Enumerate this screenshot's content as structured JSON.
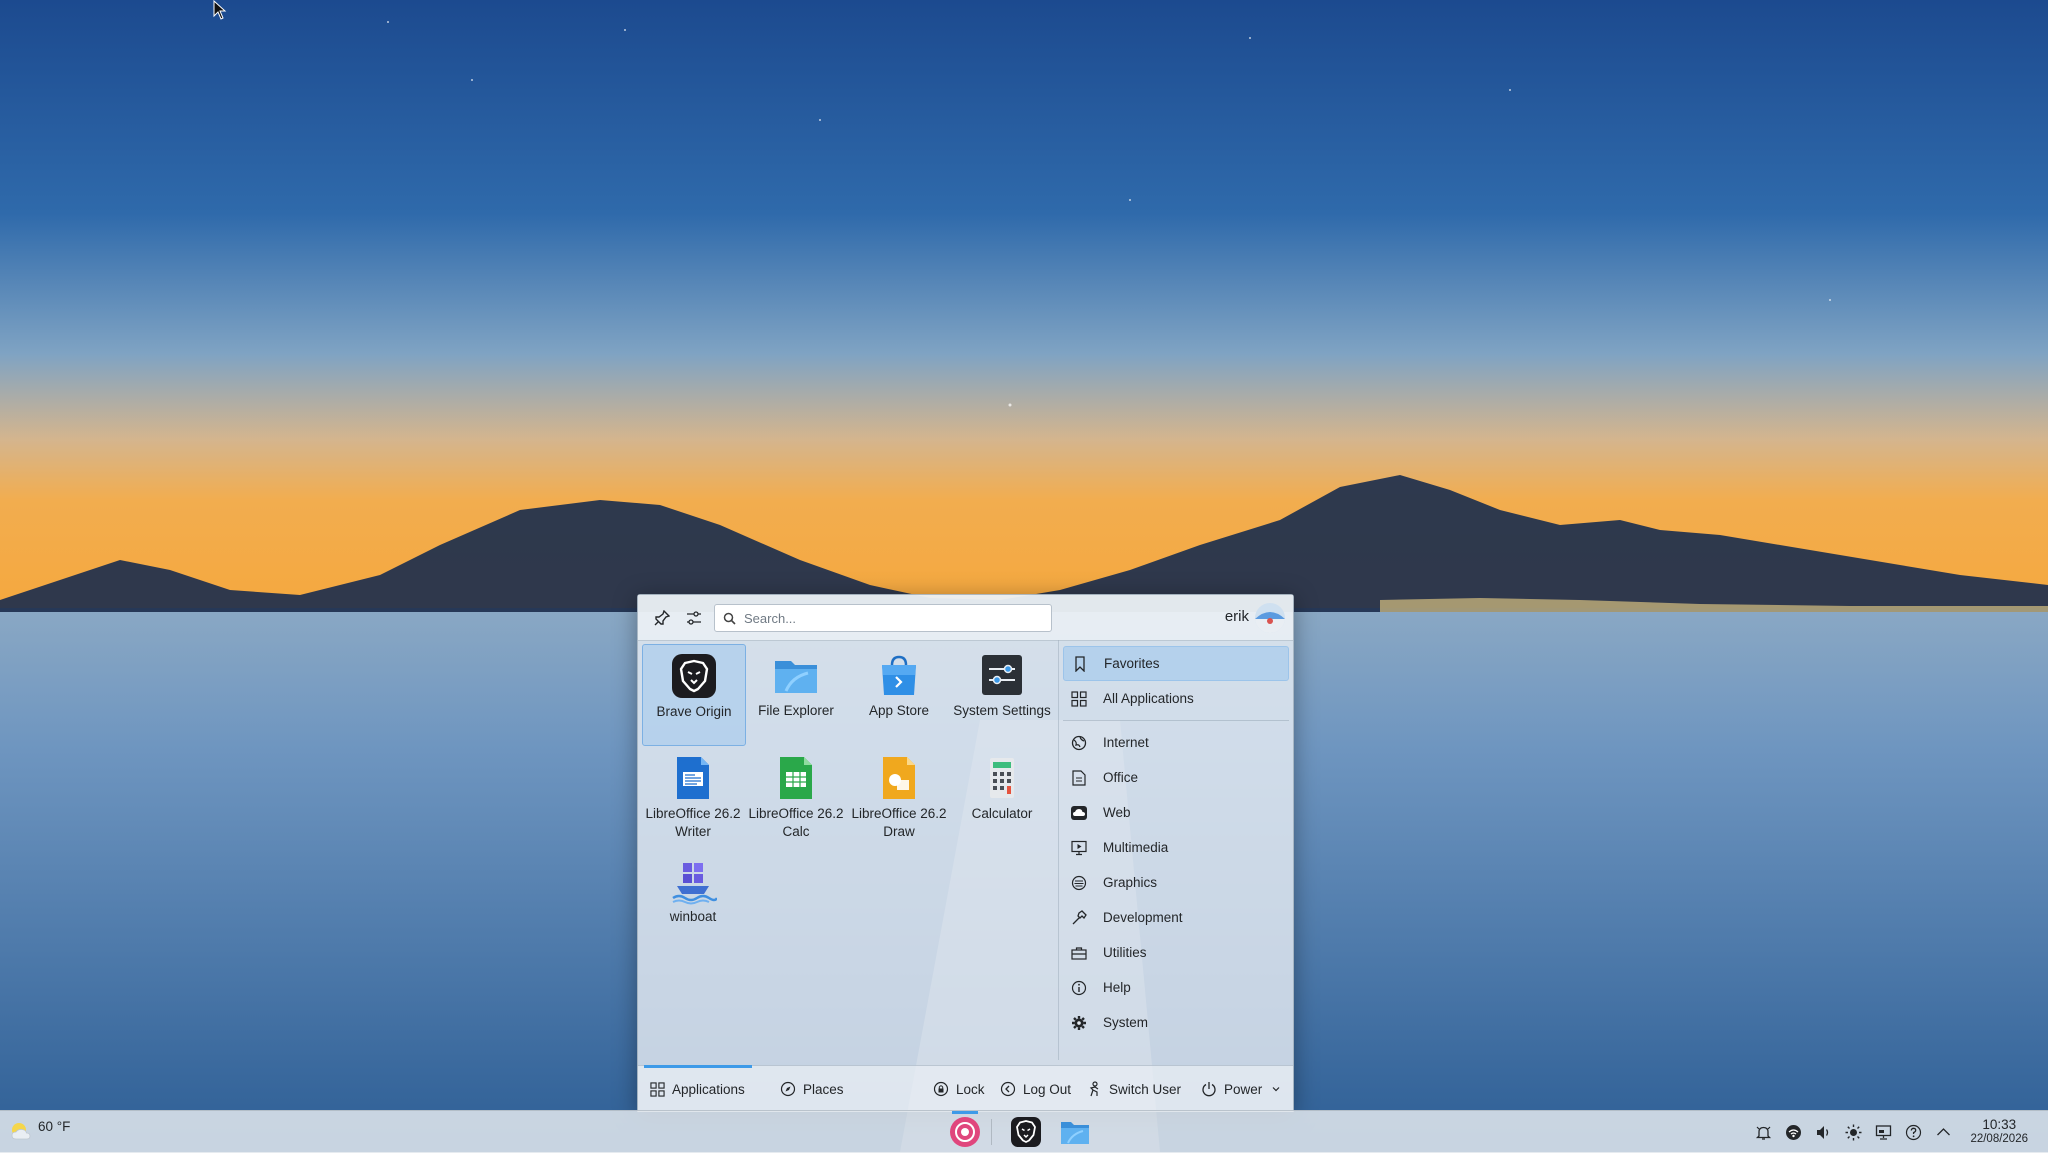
{
  "launcher": {
    "search_placeholder": "Search...",
    "user_name": "erik",
    "apps": [
      {
        "name": "Brave Origin",
        "icon": "brave-lion-icon",
        "selected": true
      },
      {
        "name": "File Explorer",
        "icon": "folder-icon"
      },
      {
        "name": "App Store",
        "icon": "app-store-bag-icon"
      },
      {
        "name": "System Settings",
        "icon": "settings-sliders-icon"
      },
      {
        "name": "LibreOffice 26.2 Writer",
        "icon": "writer-document-icon"
      },
      {
        "name": "LibreOffice 26.2 Calc",
        "icon": "calc-spreadsheet-icon"
      },
      {
        "name": "LibreOffice 26.2 Draw",
        "icon": "draw-shapes-icon"
      },
      {
        "name": "Calculator",
        "icon": "calculator-icon"
      },
      {
        "name": "winboat",
        "icon": "winboat-ship-icon"
      }
    ],
    "categories": [
      {
        "label": "Favorites",
        "icon": "bookmark-icon",
        "selected": true
      },
      {
        "label": "All Applications",
        "icon": "grid-icon"
      },
      {
        "label": "Internet",
        "icon": "globe-icon"
      },
      {
        "label": "Office",
        "icon": "document-icon"
      },
      {
        "label": "Web",
        "icon": "cloud-icon"
      },
      {
        "label": "Multimedia",
        "icon": "monitor-play-icon"
      },
      {
        "label": "Graphics",
        "icon": "palette-icon"
      },
      {
        "label": "Development",
        "icon": "hammer-icon"
      },
      {
        "label": "Utilities",
        "icon": "toolbox-icon"
      },
      {
        "label": "Help",
        "icon": "info-icon"
      },
      {
        "label": "System",
        "icon": "gear-icon"
      }
    ],
    "footer": {
      "applications": "Applications",
      "places": "Places",
      "lock": "Lock",
      "log_out": "Log Out",
      "switch_user": "Switch User",
      "power": "Power"
    }
  },
  "taskbar": {
    "weather_temp": "60 °F",
    "clock_time": "10:33",
    "clock_date": "22/08/2026",
    "pinned": [
      "kde-launcher-icon",
      "brave-lion-icon",
      "folder-icon"
    ],
    "tray": [
      "notifications-icon",
      "network-icon",
      "volume-icon",
      "brightness-icon",
      "display-icon",
      "help-icon",
      "expand-tray-icon"
    ]
  },
  "colors": {
    "accent": "#3d9ae8",
    "selection": "#adcdec"
  }
}
